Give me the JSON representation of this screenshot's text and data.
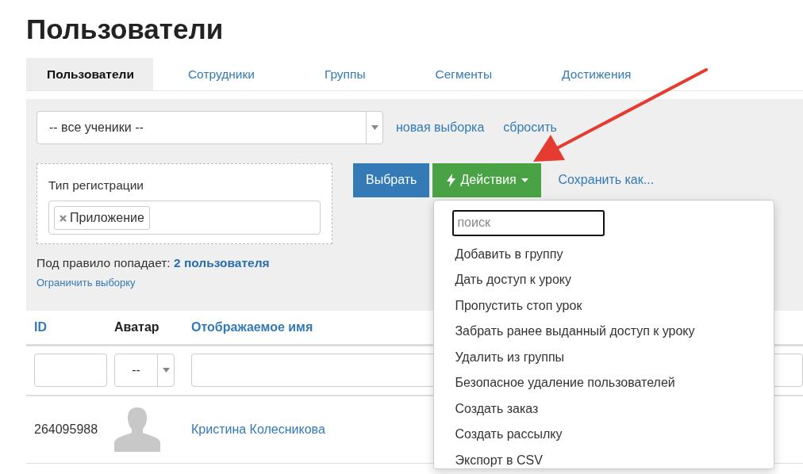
{
  "title": "Пользователи",
  "tabs": [
    {
      "label": "Пользователи",
      "selected": true
    },
    {
      "label": "Сотрудники",
      "selected": false
    },
    {
      "label": "Группы",
      "selected": false
    },
    {
      "label": "Сегменты",
      "selected": false
    },
    {
      "label": "Достижения",
      "selected": false
    }
  ],
  "filter": {
    "segment_select": {
      "value": "-- все ученики --"
    },
    "links": [
      "новая выборка",
      "сбросить"
    ],
    "rule": {
      "label": "Тип регистрации",
      "tags": [
        "Приложение"
      ]
    },
    "buttons": [
      {
        "label": "Выбрать",
        "kind": "primary"
      },
      {
        "label": "Действия",
        "kind": "dropdown"
      }
    ],
    "save_link": "Сохранить как...",
    "match_label": "Под правило попадает:",
    "match_count": "2 пользователя",
    "limit_link": "Ограничить выборку"
  },
  "actions_menu": {
    "search": {
      "placeholder": "поиск"
    },
    "items": [
      "Добавить в группу",
      "Дать доступ к уроку",
      "Пропустить стоп урок",
      "Забрать ранее выданный доступ к уроку",
      "Удалить из группы",
      "Безопасное удаление пользователей",
      "Создать заказ",
      "Создать рассылку",
      "Экспорт в CSV"
    ]
  },
  "table": {
    "columns": [
      {
        "label": "ID",
        "sortable": true
      },
      {
        "label": "Аватар",
        "sortable": false
      },
      {
        "label": "Отображаемое имя",
        "sortable": true
      }
    ],
    "filters": [
      {
        "kind": "input"
      },
      {
        "kind": "select",
        "value": "--"
      },
      {
        "kind": "input"
      }
    ],
    "rows": [
      {
        "id": "264095988",
        "name": "Кристина Колесникова"
      }
    ]
  }
}
